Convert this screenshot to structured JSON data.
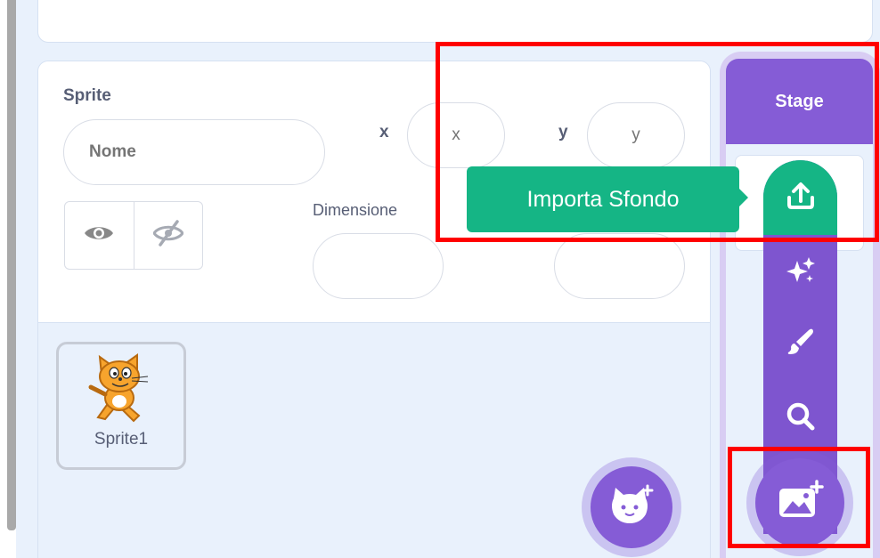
{
  "sprite_info": {
    "title": "Sprite",
    "name_placeholder": "Nome",
    "x_label": "x",
    "x_placeholder": "x",
    "y_label": "y",
    "y_placeholder": "y",
    "size_label": "Dimensione"
  },
  "sprite_list": {
    "items": [
      {
        "name": "Sprite1"
      }
    ]
  },
  "stage": {
    "header": "Stage"
  },
  "backdrop_menu": {
    "tooltip": "Importa Sfondo",
    "items": [
      {
        "icon": "upload-icon",
        "label": "Importa Sfondo"
      },
      {
        "icon": "surprise-sparkle-icon"
      },
      {
        "icon": "paint-brush-icon"
      },
      {
        "icon": "search-icon"
      }
    ]
  },
  "colors": {
    "accent": "#855cd6",
    "menu_highlight": "#15b585",
    "annotation": "#ff0000"
  }
}
